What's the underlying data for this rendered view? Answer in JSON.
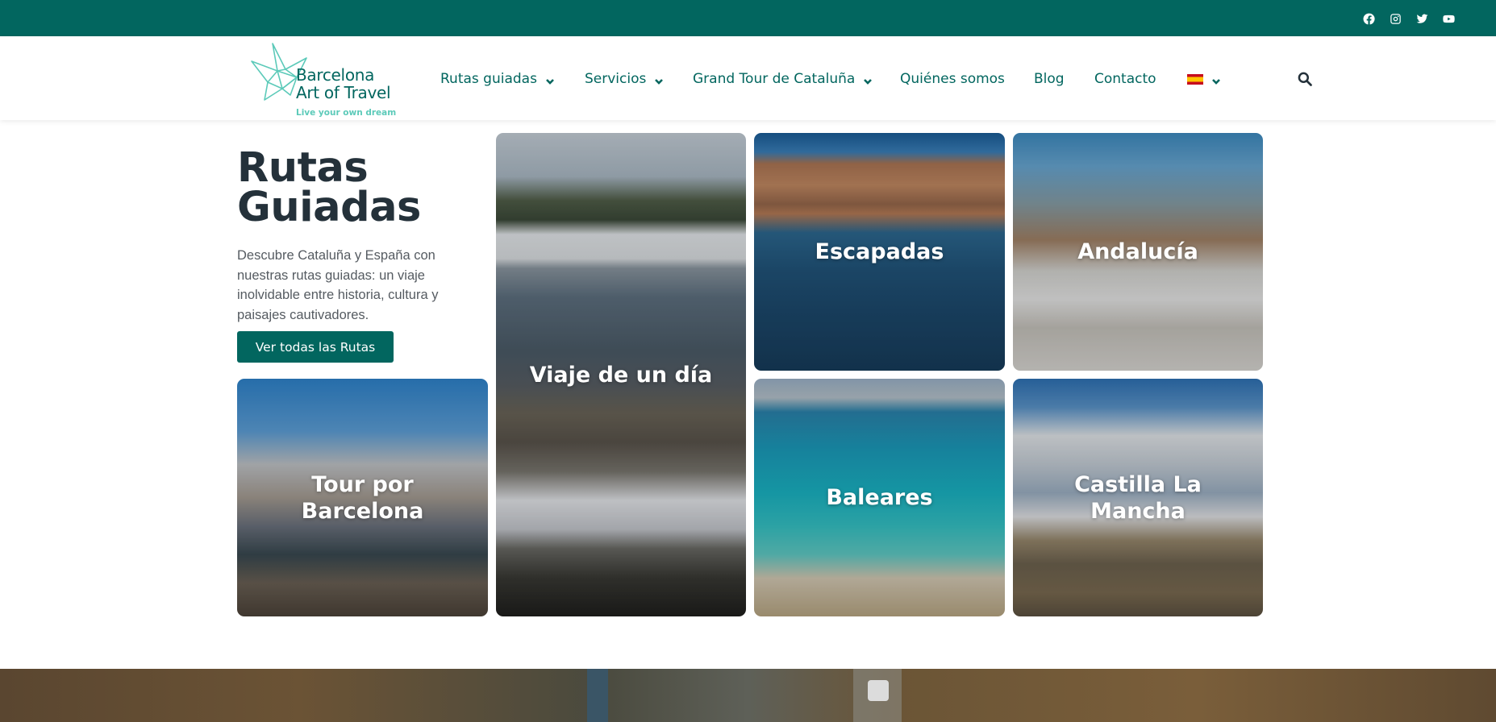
{
  "topbar": {
    "social": [
      "facebook-icon",
      "instagram-icon",
      "twitter-icon",
      "youtube-icon"
    ],
    "color": "#02665f"
  },
  "logo": {
    "line1": "Barcelona",
    "line2": "Art of Travel",
    "tagline": "Live your own dream"
  },
  "nav": {
    "items": [
      {
        "label": "Rutas guiadas",
        "dropdown": true
      },
      {
        "label": "Servicios",
        "dropdown": true
      },
      {
        "label": "Grand Tour de Cataluña",
        "dropdown": true
      },
      {
        "label": "Quiénes somos",
        "dropdown": false
      },
      {
        "label": "Blog",
        "dropdown": false
      },
      {
        "label": "Contacto",
        "dropdown": false
      }
    ],
    "language": "es-flag-icon"
  },
  "hero": {
    "title_line1": "Rutas",
    "title_line2": "Guiadas",
    "description": "Descubre Cataluña y España con nuestras rutas guiadas: un viaje inolvidable entre historia, cultura y paisajes cautivadores.",
    "cta": "Ver todas las Rutas"
  },
  "cards": {
    "viaje": "Viaje de un día",
    "escapadas": "Escapadas",
    "andalucia": "Andalucía",
    "barcelona": "Tour por Barcelona",
    "baleares": "Baleares",
    "castilla": "Castilla La Mancha"
  },
  "colors": {
    "brand": "#02665f",
    "accent": "#5ccab9",
    "heading": "#24313a"
  }
}
